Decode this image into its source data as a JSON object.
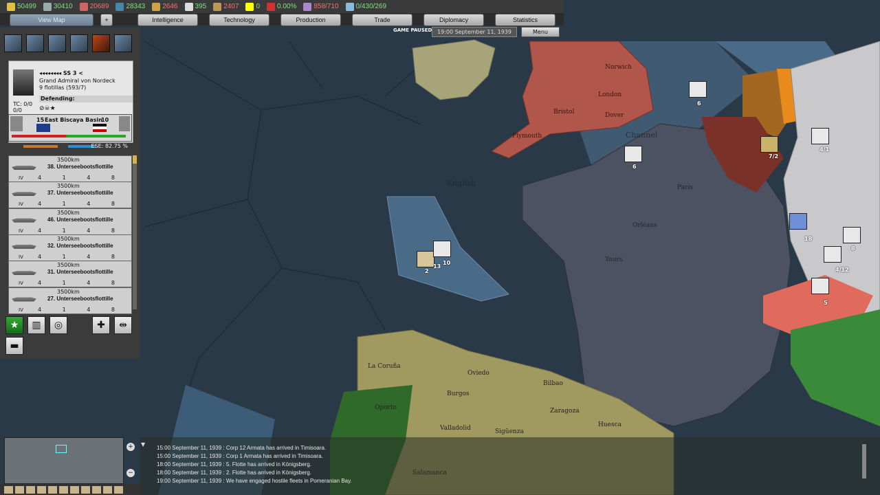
{
  "resources": [
    {
      "icon": "energy-icon",
      "value": "50499",
      "warn": false
    },
    {
      "icon": "metal-icon",
      "value": "30410",
      "warn": false
    },
    {
      "icon": "rare-materials-icon",
      "value": "20689",
      "warn": true
    },
    {
      "icon": "oil-icon",
      "value": "28343",
      "warn": false
    },
    {
      "icon": "supplies-icon",
      "value": "2646",
      "warn": true
    },
    {
      "icon": "money-icon",
      "value": "395",
      "warn": false
    },
    {
      "icon": "manpower-icon",
      "value": "2407",
      "warn": true
    },
    {
      "icon": "nuclear-icon",
      "value": "0",
      "warn": false
    },
    {
      "icon": "dissent-icon",
      "value": "0.00%",
      "warn": false
    },
    {
      "icon": "transport-icon",
      "value": "858/710",
      "warn": true
    },
    {
      "icon": "convoy-icon",
      "value": "0/430/269",
      "warn": false
    }
  ],
  "tabs": {
    "view_map": "View Map",
    "intelligence": "Intelligence",
    "technology": "Technology",
    "production": "Production",
    "trade": "Trade",
    "diplomacy": "Diplomacy",
    "statistics": "Statistics"
  },
  "status": {
    "paused": "GAME PAUSED",
    "date": "19:00 September 11, 1939",
    "menu": "Menu"
  },
  "fleet": {
    "name": "SS 3",
    "commander": "Grand Admiral von Nordeck",
    "flotillas": "9 flotillas (593/7)",
    "tc": "TC: 0/0",
    "tc2": "0/0",
    "mission": "Defending:",
    "combat_left": "15",
    "combat_location": "East Biscaya Basin",
    "combat_right": "10",
    "ese": "ESE: 82.75 %"
  },
  "units": [
    {
      "range": "3500km",
      "name": "38. Unterseebootsflottille",
      "level": "IV",
      "stats": "4 1 4 8"
    },
    {
      "range": "3500km",
      "name": "37. Unterseebootsflottille",
      "level": "IV",
      "stats": "4 1 4 8"
    },
    {
      "range": "3500km",
      "name": "46. Unterseebootsflottille",
      "level": "IV",
      "stats": "4 1 4 8"
    },
    {
      "range": "3500km",
      "name": "32. Unterseebootsflottille",
      "level": "IV",
      "stats": "4 1 4 8"
    },
    {
      "range": "3500km",
      "name": "31. Unterseebootsflottille",
      "level": "IV",
      "stats": "4 1 4 8"
    },
    {
      "range": "3500km",
      "name": "27. Unterseebootsflottille",
      "level": "IV",
      "stats": "4 1 4 8"
    }
  ],
  "log": [
    "15:00 September 11, 1939 : Corp 12 Armata has arrived in Timisoara.",
    "15:00 September 11, 1939 : Corp 1 Armata has arrived in Timisoara.",
    "18:00 September 11, 1939 : 5. Flotte has arrived in Königsberg.",
    "18:00 September 11, 1939 : 2. Flotte has arrived in Königsberg.",
    "19:00 September 11, 1939 : We have engaged hostile fleets in Pomeranian Bay."
  ],
  "map_labels": [
    "English",
    "Channel",
    "La Coruña",
    "Oviedo",
    "Bilbao",
    "Burgos",
    "Oporto",
    "Valladolid",
    "Sigüenza",
    "Zaragoza",
    "Huesca",
    "Salamanca",
    "Plymouth",
    "Dover",
    "London",
    "Norwich",
    "Bristol",
    "Orléans",
    "Tours",
    "Paris"
  ],
  "map_counters": [
    "2",
    "13",
    "10",
    "6",
    "6",
    "7/2",
    "18",
    "4/12",
    "5",
    "4/1",
    "8"
  ]
}
